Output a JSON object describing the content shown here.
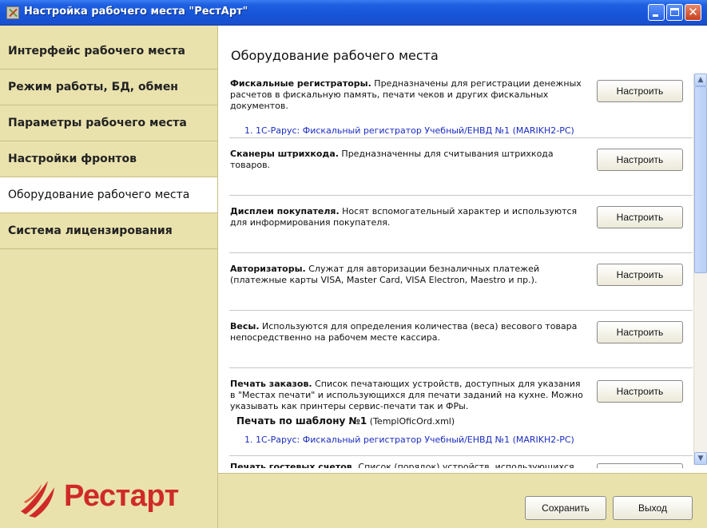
{
  "window": {
    "title": "Настройка рабочего места \"РестАрт\"",
    "close_glyph": "✕"
  },
  "sidebar": {
    "items": [
      {
        "label": "Интерфейс рабочего места",
        "active": false
      },
      {
        "label": "Режим работы, БД, обмен",
        "active": false
      },
      {
        "label": "Параметры рабочего места",
        "active": false
      },
      {
        "label": "Настройки фронтов",
        "active": false
      },
      {
        "label": "Оборудование рабочего места",
        "active": true
      },
      {
        "label": "Система лицензирования",
        "active": false
      }
    ],
    "logo_text": "Рестарт"
  },
  "main": {
    "title": "Оборудование рабочего места",
    "configure_label": "Настроить",
    "sections": [
      {
        "name": "Фискальные регистраторы.",
        "text": " Предназначены для регистрации денежных расчетов в фискальную память, печати чеков и других фискальных документов.",
        "link": "1. 1С-Рарус: Фискальный регистратор Учебный/ЕНВД №1  (MARIKH2-PC)"
      },
      {
        "name": "Сканеры штрихкода.",
        "text": " Предназначенны для считывания штрихкода товаров."
      },
      {
        "name": "Дисплеи покупателя.",
        "text": " Носят вспомогательный характер и используются для информирования покупателя."
      },
      {
        "name": "Авторизаторы.",
        "text": " Служат для авторизации безналичных платежей (платежные карты VISA, Master Card, VISA Electron, Maestro и пр.)."
      },
      {
        "name": "Весы.",
        "text": " Используются для определения количества (веса) весового товара непосредственно на рабочем месте кассира."
      },
      {
        "name": "Печать заказов.",
        "text": " Список печатающих устройств, доступных для указания в \"Местах печати\" и использующихся для печати заданий на кухне. Можно указывать как принтеры сервис-печати так и ФРы.",
        "sub_title": "Печать по шаблону №1",
        "sub_title_file": " (TemplOficOrd.xml)",
        "link": "1. 1С-Рарус: Фискальный регистратор Учебный/ЕНВД №1  (MARIKH2-PC)"
      },
      {
        "name": "Печать гостевых счетов.",
        "text": " Список (порядок) устройств, использующихся"
      }
    ]
  },
  "scrollbar": {
    "up_glyph": "▲",
    "down_glyph": "▼"
  },
  "footer": {
    "save_label": "Сохранить",
    "exit_label": "Выход"
  },
  "colors": {
    "titlebar": "#1f5fe0",
    "sidebar_bg": "#e9e2ad",
    "link": "#1a2cc2",
    "logo": "#cf2a27"
  }
}
